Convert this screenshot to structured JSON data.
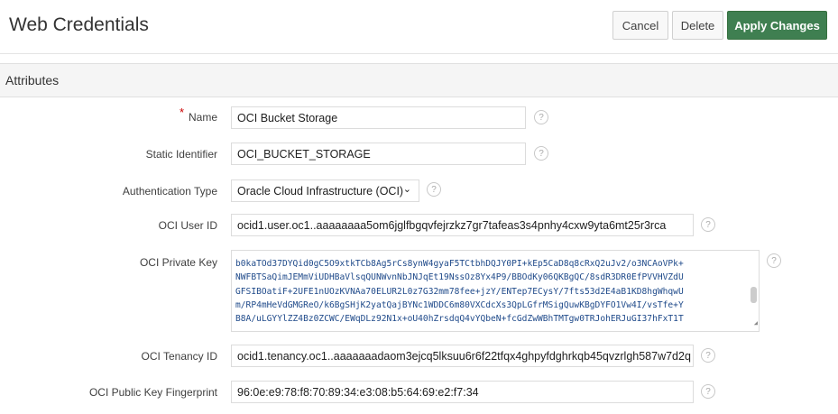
{
  "header": {
    "title": "Web Credentials",
    "cancel": "Cancel",
    "delete": "Delete",
    "apply": "Apply Changes"
  },
  "region": {
    "title": "Attributes"
  },
  "fields": {
    "name": {
      "label": "Name",
      "value": "OCI Bucket Storage",
      "required": true
    },
    "static_id": {
      "label": "Static Identifier",
      "value": "OCI_BUCKET_STORAGE"
    },
    "auth_type": {
      "label": "Authentication Type",
      "value": "Oracle Cloud Infrastructure (OCI)"
    },
    "user_id": {
      "label": "OCI User ID",
      "value": "ocid1.user.oc1..aaaaaaaa5om6jglfbgqvfejrzkz7gr7tafeas3s4pnhy4cxw9yta6mt25r3rca"
    },
    "private_key": {
      "label": "OCI Private Key",
      "lines": [
        "",
        "b0kaTOd37DYQid0gC5O9xtkTCb8Ag5rCs8ynW4gyaF5TCtbhDQJY0PI+kEp5CaD8q8cRxQ2uJv2/o3NCAoVPk+",
        "NWFBTSaQimJEMmViUDHBaVlsqQUNWvnNbJNJqEt19NssOz8Yx4P9/BBOdKy06QKBgQC/8sdR3DR0EfPVVHVZdU",
        "GFSIBOatiF+2UFE1nUOzKVNAa70ELUR2L0z7G32mm78fee+jzY/ENTep7ECysY/7fts53d2E4aB1KD8hgWhqwU",
        "m/RP4mHeVdGMGReO/k6BgSHjK2yatQajBYNc1WDDC6m80VXCdcXs3QpLGfrMSigQuwKBgDYFO1Vw4I/vsTfe+Y",
        "B8A/uLGYYlZZ4Bz0ZCWC/EWqDLz92N1x+oU40hZrsdqQ4vYQbeN+fcGdZwWBhTMTgw0TRJohERJuGI37hFxT1T"
      ]
    },
    "tenancy_id": {
      "label": "OCI Tenancy ID",
      "value": "ocid1.tenancy.oc1..aaaaaaadaom3ejcq5lksuu6r6f22tfqx4ghpyfdghrkqb45qvzrlgh587w7d2q"
    },
    "fingerprint": {
      "label": "OCI Public Key Fingerprint",
      "value": "96:0e:e9:78:f8:70:89:34:e3:08:b5:64:69:e2:f7:34"
    }
  },
  "help_glyph": "?",
  "colors": {
    "primary_button": "#3f7f51",
    "required": "#cc0000"
  }
}
